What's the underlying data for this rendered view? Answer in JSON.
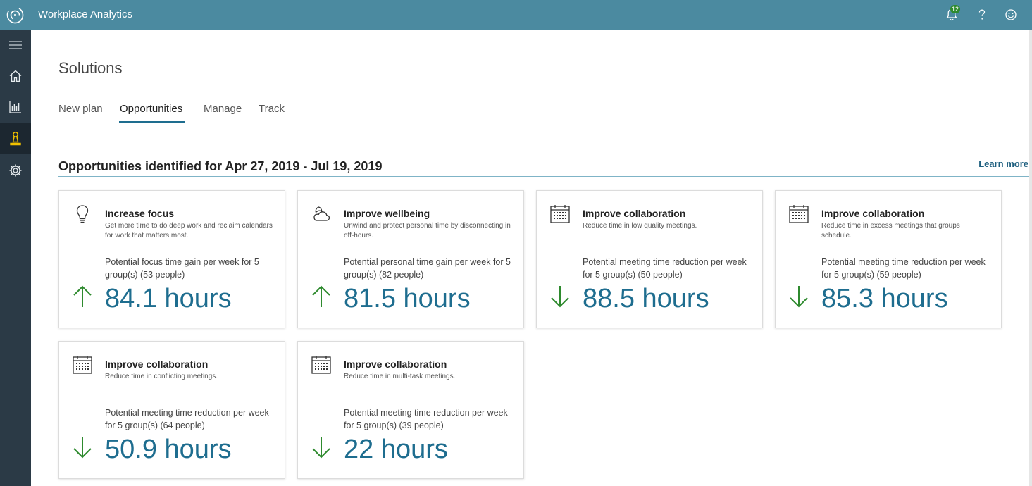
{
  "app": {
    "title": "Workplace Analytics",
    "notification_count": "12"
  },
  "header_icons": [
    "bell-icon",
    "help-icon",
    "smiley-feedback-icon"
  ],
  "sidebar": {
    "items": [
      {
        "name": "hamburger-menu-icon",
        "active": false
      },
      {
        "name": "home-icon",
        "active": false
      },
      {
        "name": "bar-chart-icon",
        "active": false
      },
      {
        "name": "solutions-icon",
        "active": true
      },
      {
        "name": "gear-icon",
        "active": false
      }
    ]
  },
  "page": {
    "title": "Solutions"
  },
  "tabs": [
    {
      "label": "New plan",
      "active": false
    },
    {
      "label": "Opportunities",
      "active": true
    },
    {
      "label": "Manage",
      "active": false
    },
    {
      "label": "Track",
      "active": false
    }
  ],
  "section": {
    "title": "Opportunities identified for Apr 27, 2019 - Jul 19, 2019",
    "learn_more": "Learn more"
  },
  "cards": [
    {
      "icon": "lightbulb-icon",
      "title": "Increase focus",
      "desc": "Get more time to do deep work and reclaim calendars for work that matters most.",
      "metric": "Potential focus time gain per week for 5 group(s) (53 people)",
      "trend": "up",
      "value": "84.1 hours"
    },
    {
      "icon": "moon-cloud-icon",
      "title": "Improve wellbeing",
      "desc": "Unwind and protect personal time by disconnecting in off-hours.",
      "metric": "Potential personal time gain per week for 5 group(s) (82 people)",
      "trend": "up",
      "value": "81.5 hours"
    },
    {
      "icon": "calendar-icon",
      "title": "Improve collaboration",
      "desc": "Reduce time in low quality meetings.",
      "metric": "Potential meeting time reduction per week for 5 group(s) (50 people)",
      "trend": "down",
      "value": "88.5 hours"
    },
    {
      "icon": "calendar-icon",
      "title": "Improve collaboration",
      "desc": "Reduce time in excess meetings that groups schedule.",
      "metric": "Potential meeting time reduction per week for 5 group(s) (59 people)",
      "trend": "down",
      "value": "85.3 hours"
    },
    {
      "icon": "calendar-icon",
      "title": "Improve collaboration",
      "desc": "Reduce time in conflicting meetings.",
      "metric": "Potential meeting time reduction per week for 5 group(s) (64 people)",
      "trend": "down",
      "value": "50.9 hours"
    },
    {
      "icon": "calendar-icon",
      "title": "Improve collaboration",
      "desc": "Reduce time in multi-task meetings.",
      "metric": "Potential meeting time reduction per week for 5 group(s) (39 people)",
      "trend": "down",
      "value": "22 hours"
    }
  ],
  "colors": {
    "topbar": "#4b8aa0",
    "sidebar": "#2b3a46",
    "accent": "#1e6d8f",
    "arrow": "#2e8a2e"
  }
}
